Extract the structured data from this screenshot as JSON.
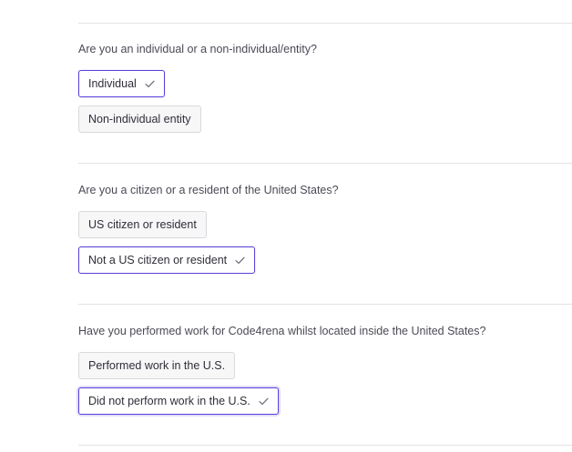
{
  "colors": {
    "accent": "#5b3fd6",
    "divider": "#e3e3e6",
    "option_bg": "#f7f7f8",
    "option_border": "#d9d9de"
  },
  "questions": [
    {
      "prompt": "Are you an individual or a non-individual/entity?",
      "options": [
        {
          "label": "Individual",
          "selected": true
        },
        {
          "label": "Non-individual entity",
          "selected": false
        }
      ]
    },
    {
      "prompt": "Are you a citizen or a resident of the United States?",
      "options": [
        {
          "label": "US citizen or resident",
          "selected": false
        },
        {
          "label": "Not a US citizen or resident",
          "selected": true
        }
      ]
    },
    {
      "prompt": "Have you performed work for Code4rena whilst located inside the United States?",
      "options": [
        {
          "label": "Performed work in the U.S.",
          "selected": false
        },
        {
          "label": "Did not perform work in the U.S.",
          "selected": true
        }
      ]
    }
  ],
  "icons": {
    "selected_indicator": "check-icon"
  }
}
